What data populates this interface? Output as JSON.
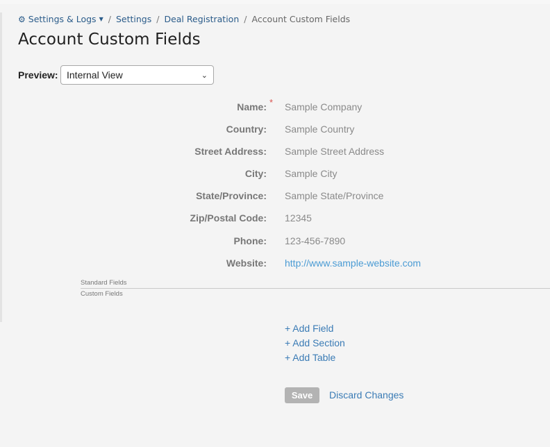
{
  "breadcrumb": {
    "settings_logs": "Settings & Logs",
    "settings": "Settings",
    "deal_registration": "Deal Registration",
    "current": "Account Custom Fields",
    "separator": "/"
  },
  "page_title": "Account Custom Fields",
  "preview": {
    "label": "Preview:",
    "selected": "Internal View"
  },
  "fields": [
    {
      "label": "Name:",
      "value": "Sample Company",
      "required": "*"
    },
    {
      "label": "Country:",
      "value": "Sample Country"
    },
    {
      "label": "Street Address:",
      "value": "Sample Street Address"
    },
    {
      "label": "City:",
      "value": "Sample City"
    },
    {
      "label": "State/Province:",
      "value": "Sample State/Province"
    },
    {
      "label": "Zip/Postal Code:",
      "value": "12345"
    },
    {
      "label": "Phone:",
      "value": "123-456-7890"
    },
    {
      "label": "Website:",
      "value": "http://www.sample-website.com"
    }
  ],
  "sections": {
    "standard": "Standard Fields",
    "custom": "Custom Fields"
  },
  "actions": {
    "add_field": "+ Add Field",
    "add_section": "+ Add Section",
    "add_table": "+ Add Table",
    "save": "Save",
    "discard": "Discard Changes"
  },
  "icons": {
    "settings": "gear-icon",
    "dropdown": "caret-down-icon",
    "select": "chevron-down-icon"
  }
}
